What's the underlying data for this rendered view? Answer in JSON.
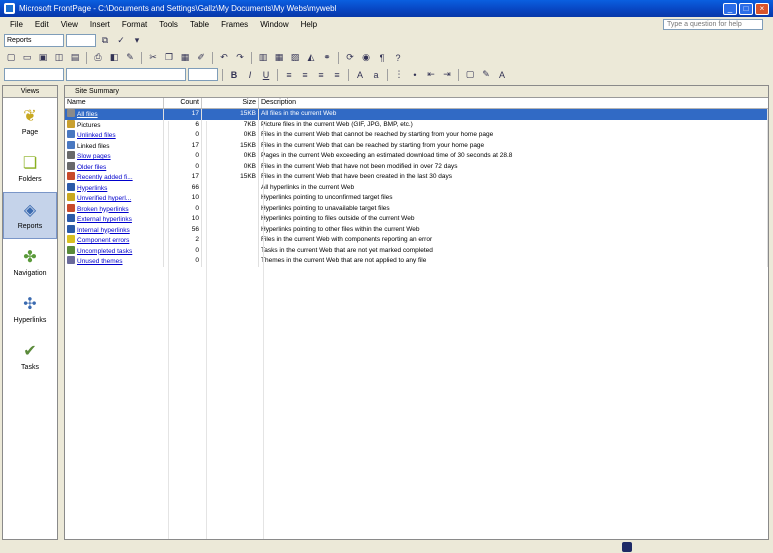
{
  "window": {
    "title": "Microsoft FrontPage - C:\\Documents and Settings\\Gallz\\My Documents\\My Webs\\mywebl",
    "min": "_",
    "max": "□",
    "close": "×"
  },
  "menu": [
    "File",
    "Edit",
    "View",
    "Insert",
    "Format",
    "Tools",
    "Table",
    "Frames",
    "Window",
    "Help"
  ],
  "help_placeholder": "Type a question for help",
  "toolbar": {
    "reports_label": "Reports"
  },
  "views": {
    "header": "Views",
    "items": [
      {
        "label": "Page",
        "icon": "page-icon"
      },
      {
        "label": "Folders",
        "icon": "folder-icon"
      },
      {
        "label": "Reports",
        "icon": "reports-icon"
      },
      {
        "label": "Navigation",
        "icon": "navigation-icon"
      },
      {
        "label": "Hyperlinks",
        "icon": "hyperlinks-icon"
      },
      {
        "label": "Tasks",
        "icon": "tasks-icon"
      }
    ]
  },
  "report": {
    "tab": "Site Summary",
    "columns": {
      "name": "Name",
      "count": "Count",
      "size": "Size",
      "description": "Description"
    },
    "rows": [
      {
        "name": "All files",
        "count": "17",
        "size": "15KB",
        "description": "All files in the current Web",
        "link": true,
        "color": "#8a8a8a"
      },
      {
        "name": "Pictures",
        "count": "6",
        "size": "7KB",
        "description": "Picture files in the current Web (GIF, JPG, BMP, etc.)",
        "link": false,
        "color": "#c9a030"
      },
      {
        "name": "Unlinked files",
        "count": "0",
        "size": "0KB",
        "description": "Files in the current Web that cannot be reached by starting from your home page",
        "link": true,
        "color": "#4a78c0"
      },
      {
        "name": "Linked files",
        "count": "17",
        "size": "15KB",
        "description": "Files in the current Web that can be reached by starting from your home page",
        "link": false,
        "color": "#4a78c0"
      },
      {
        "name": "Slow pages",
        "count": "0",
        "size": "0KB",
        "description": "Pages in the current Web exceeding an estimated download time of 30 seconds at 28.8",
        "link": true,
        "color": "#6a6a6a"
      },
      {
        "name": "Older files",
        "count": "0",
        "size": "0KB",
        "description": "Files in the current Web that have not been modified in over 72 days",
        "link": true,
        "color": "#6a6a6a"
      },
      {
        "name": "Recently added fi...",
        "count": "17",
        "size": "15KB",
        "description": "Files in the current Web that have been created in the last 30 days",
        "link": true,
        "color": "#c84a2a"
      },
      {
        "name": "Hyperlinks",
        "count": "66",
        "size": "",
        "description": "All hyperlinks in the current Web",
        "link": true,
        "color": "#2a5aa8"
      },
      {
        "name": "Unverified hyperl...",
        "count": "10",
        "size": "",
        "description": "Hyperlinks pointing to unconfirmed target files",
        "link": true,
        "color": "#c8a820"
      },
      {
        "name": "Broken hyperlinks",
        "count": "0",
        "size": "",
        "description": "Hyperlinks pointing to unavailable target files",
        "link": true,
        "color": "#c84a2a"
      },
      {
        "name": "External hyperlinks",
        "count": "10",
        "size": "",
        "description": "Hyperlinks pointing to files outside of the current Web",
        "link": true,
        "color": "#2a5aa8"
      },
      {
        "name": "Internal hyperlinks",
        "count": "56",
        "size": "",
        "description": "Hyperlinks pointing to other files within the current Web",
        "link": true,
        "color": "#2a5aa8"
      },
      {
        "name": "Component errors",
        "count": "2",
        "size": "",
        "description": "Files in the current Web with components reporting an error",
        "link": true,
        "color": "#d8c020"
      },
      {
        "name": "Uncompleted tasks",
        "count": "0",
        "size": "",
        "description": "Tasks in the current Web that are not yet marked completed",
        "link": true,
        "color": "#5a8a3a"
      },
      {
        "name": "Unused themes",
        "count": "0",
        "size": "",
        "description": "Themes in the current Web that are not applied to any file",
        "link": true,
        "color": "#6a6a9a"
      }
    ]
  }
}
